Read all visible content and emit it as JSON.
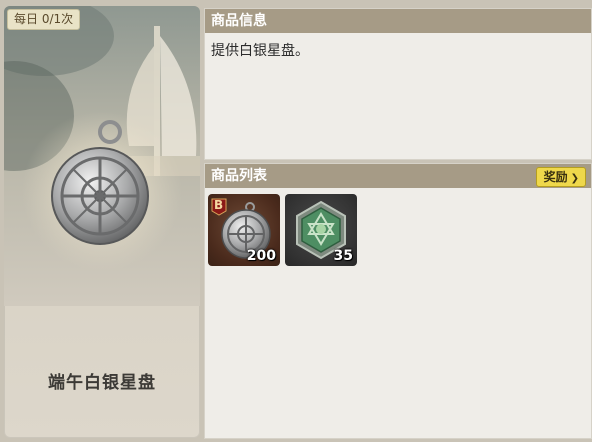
{
  "left_card": {
    "daily_limit": "每日 0/1次",
    "item_name": "端午白银星盘"
  },
  "info_panel": {
    "title": "商品信息",
    "description": "提供白银星盘。"
  },
  "list_panel": {
    "title": "商品列表",
    "reward_button": "奖励",
    "items": [
      {
        "icon": "silver-astrolabe-icon",
        "grade": "B",
        "count": "200"
      },
      {
        "icon": "green-emblem-icon",
        "count": "35"
      }
    ]
  },
  "colors": {
    "panel_header": "#a69b86",
    "panel_bg": "#efede8",
    "reward_button": "#efd84b"
  }
}
